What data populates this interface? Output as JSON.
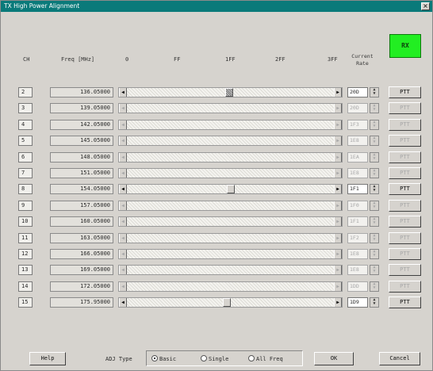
{
  "window": {
    "title": "TX High Power Alignment",
    "close_label": "×"
  },
  "header": {
    "ch": "CH",
    "freq": "Freq [MHz]",
    "scale": [
      "0",
      "FF",
      "1FF",
      "2FF",
      "3FF"
    ],
    "current_rate": "Current Rate"
  },
  "rx_button": "RX",
  "rows": [
    {
      "ch": "2",
      "freq": "136.05000",
      "rate": "20D",
      "ptt": "PTT",
      "enabled": true,
      "level": 0.47
    },
    {
      "ch": "3",
      "freq": "139.05000",
      "rate": "20D",
      "ptt": "PTT",
      "enabled": false
    },
    {
      "ch": "4",
      "freq": "142.05000",
      "rate": "1F3",
      "ptt": "PTT",
      "enabled": false
    },
    {
      "ch": "5",
      "freq": "145.05000",
      "rate": "1E8",
      "ptt": "PTT",
      "enabled": false
    },
    {
      "ch": "6",
      "freq": "148.05000",
      "rate": "1EA",
      "ptt": "PTT",
      "enabled": false
    },
    {
      "ch": "7",
      "freq": "151.05000",
      "rate": "1E8",
      "ptt": "PTT",
      "enabled": false
    },
    {
      "ch": "8",
      "freq": "154.05000",
      "rate": "1F1",
      "ptt": "PTT",
      "enabled": true,
      "level": 0.48
    },
    {
      "ch": "9",
      "freq": "157.05000",
      "rate": "1F0",
      "ptt": "PTT",
      "enabled": false
    },
    {
      "ch": "10",
      "freq": "160.05000",
      "rate": "1F1",
      "ptt": "PTT",
      "enabled": false
    },
    {
      "ch": "11",
      "freq": "163.05000",
      "rate": "1F2",
      "ptt": "PTT",
      "enabled": false
    },
    {
      "ch": "12",
      "freq": "166.05000",
      "rate": "1E8",
      "ptt": "PTT",
      "enabled": false
    },
    {
      "ch": "13",
      "freq": "169.05000",
      "rate": "1E8",
      "ptt": "PTT",
      "enabled": false
    },
    {
      "ch": "14",
      "freq": "172.05000",
      "rate": "1DD",
      "ptt": "PTT",
      "enabled": false
    },
    {
      "ch": "15",
      "freq": "175.95000",
      "rate": "1D9",
      "ptt": "PTT",
      "enabled": true,
      "level": 0.46
    }
  ],
  "footer": {
    "help": "Help",
    "adj_type_label": "ADJ Type",
    "adj_options": [
      "Basic",
      "Single",
      "All Freq"
    ],
    "adj_selected": "Basic",
    "ok": "OK",
    "cancel": "Cancel"
  },
  "colors": {
    "title_bar": "#0a7a7a",
    "rx_button": "#22ee22",
    "dialog_bg": "#d6d3ce"
  }
}
